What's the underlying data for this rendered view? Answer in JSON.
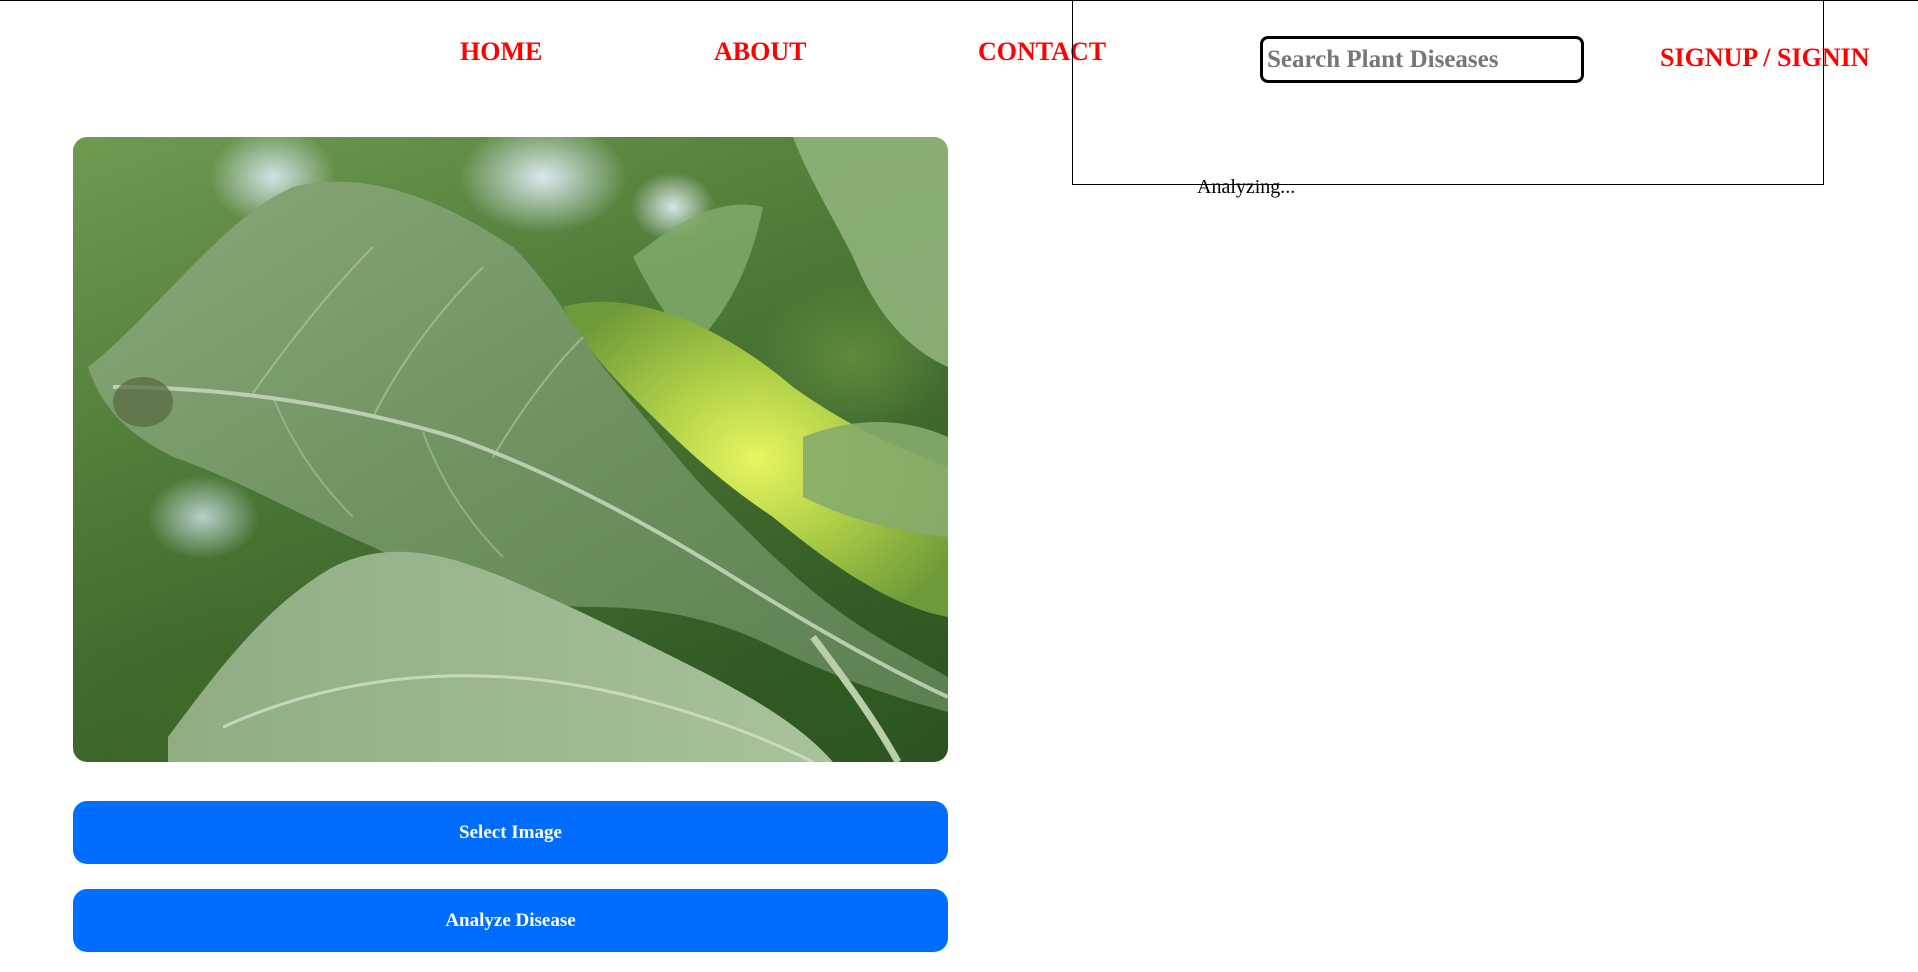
{
  "nav": {
    "home": "HOME",
    "about": "ABOUT",
    "contact": "CONTACT",
    "auth": "SIGNUP / SIGNIN"
  },
  "search": {
    "placeholder": "Search Plant Diseases",
    "value": ""
  },
  "status": {
    "text": "Analyzing..."
  },
  "image": {
    "subject": "leaf-photo"
  },
  "actions": {
    "select_label": "Select Image",
    "analyze_label": "Analyze Disease"
  },
  "colors": {
    "nav_link": "#ff0000",
    "button_bg": "#006dff",
    "button_text": "#ffffff",
    "search_text": "#777777"
  }
}
